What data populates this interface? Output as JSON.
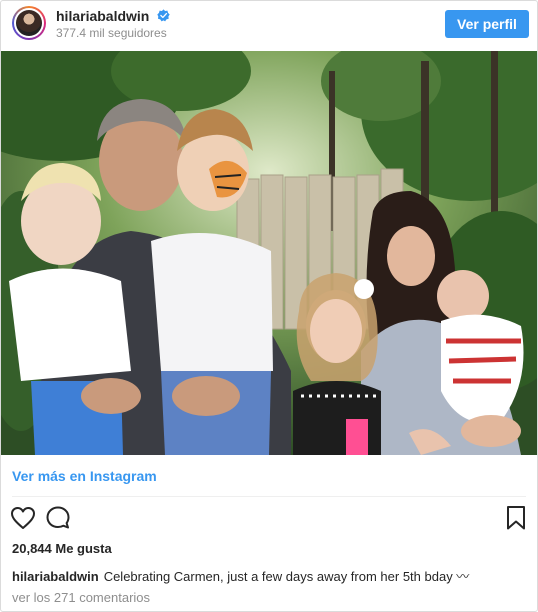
{
  "header": {
    "username": "hilariabaldwin",
    "verified": true,
    "followers": "377.4 mil seguidores",
    "view_profile_label": "Ver perfil"
  },
  "photo": {
    "icon": "family-photo"
  },
  "view_more_label": "Ver más en Instagram",
  "actions": {
    "like_icon": "heart-icon",
    "comment_icon": "comment-icon",
    "save_icon": "bookmark-icon"
  },
  "likes_text": "20,844 Me gusta",
  "caption": {
    "username": "hilariabaldwin",
    "text": "Celebrating Carmen, just a few days away from her 5th bday 〰"
  },
  "comments_link": "ver los 271 comentarios",
  "colors": {
    "accent_blue": "#3897f0",
    "text": "#262626",
    "muted": "#8e8e8e",
    "border": "#dbdbdb"
  }
}
